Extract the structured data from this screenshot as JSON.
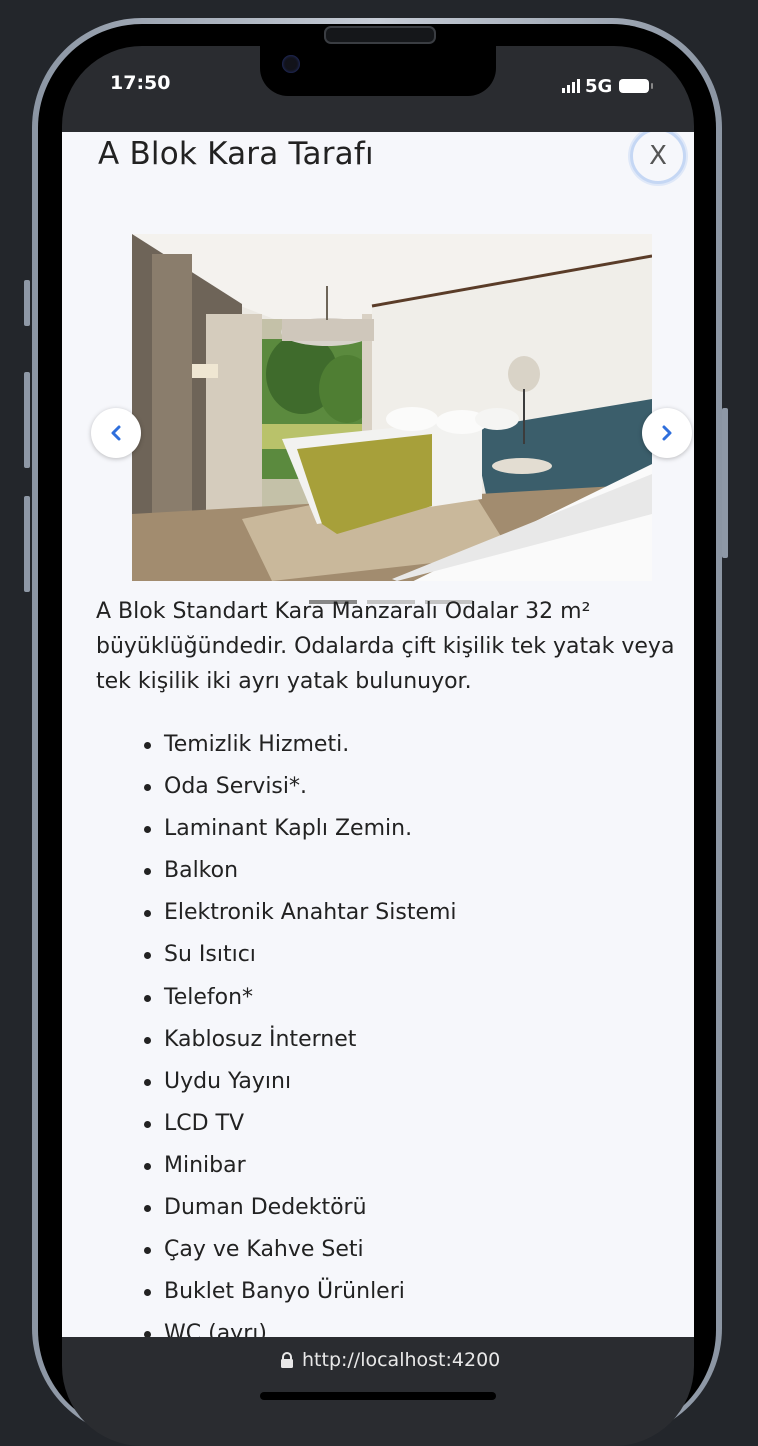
{
  "status_bar": {
    "time": "17:50",
    "network": "5G"
  },
  "modal": {
    "title": "A Blok Kara Tarafı",
    "close_label": "X"
  },
  "carousel": {
    "slide_count": 3,
    "active_index": 0
  },
  "description": "A Blok Standart Kara Manzaralı Odalar 32 m² büyüklüğündedir. Odalarda çift kişilik tek yatak veya tek kişilik iki ayrı yatak bulunuyor.",
  "features": [
    "Temizlik Hizmeti.",
    "Oda Servisi*.",
    "Laminant Kaplı Zemin.",
    "Balkon",
    "Elektronik Anahtar Sistemi",
    "Su Isıtıcı",
    "Telefon*",
    "Kablosuz İnternet",
    "Uydu Yayını",
    "LCD TV",
    "Minibar",
    "Duman Dedektörü",
    "Çay ve Kahve Seti",
    "Buklet Banyo Ürünleri",
    "WC (ayrı)"
  ],
  "browser": {
    "url": "http://localhost:4200"
  },
  "colors": {
    "accent": "#2f6fdc",
    "page_bg": "#f6f7fb",
    "text": "#222222"
  }
}
